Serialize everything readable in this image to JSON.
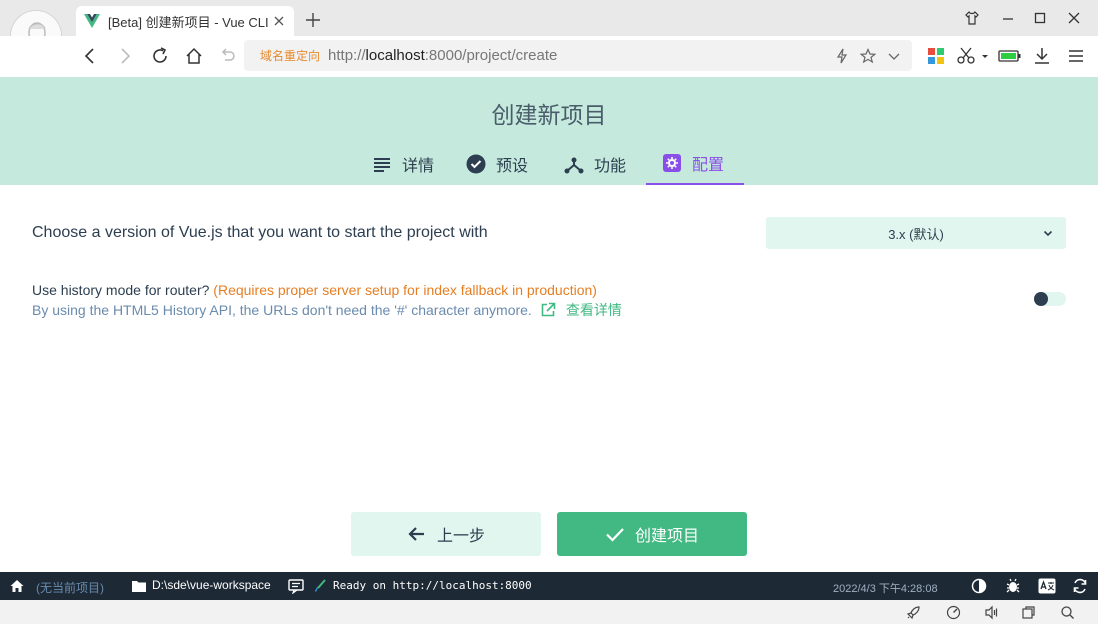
{
  "browser": {
    "tab_title": "[Beta] 创建新项目 - Vue CLI",
    "address": {
      "redirect_label": "域名重定向",
      "url_scheme": "http://",
      "url_host": "localhost",
      "url_rest": ":8000/project/create"
    }
  },
  "page": {
    "title": "创建新项目",
    "tabs": [
      {
        "label": "详情",
        "icon": "list-icon"
      },
      {
        "label": "预设",
        "icon": "check-circle-icon"
      },
      {
        "label": "功能",
        "icon": "branch-icon"
      },
      {
        "label": "配置",
        "icon": "settings-icon"
      }
    ],
    "active_tab": "配置",
    "accent_color": "#42b983",
    "active_tab_color": "#8a4fe8"
  },
  "config": {
    "vue_version": {
      "label": "Choose a version of Vue.js that you want to start the project with",
      "selected": "3.x (默认)"
    },
    "history_mode": {
      "label": "Use history mode for router?",
      "warning": "(Requires proper server setup for index fallback in production)",
      "description": "By using the HTML5 History API, the URLs don't need the '#' character anymore.",
      "link_label": "查看详情",
      "enabled": false
    }
  },
  "actions": {
    "prev_label": "上一步",
    "create_label": "创建项目"
  },
  "statusbar": {
    "no_project": "(无当前项目)",
    "path": "D:\\sde\\vue-workspace",
    "log": "Ready on http://localhost:8000",
    "time": "2022/4/3 下午4:28:08"
  }
}
